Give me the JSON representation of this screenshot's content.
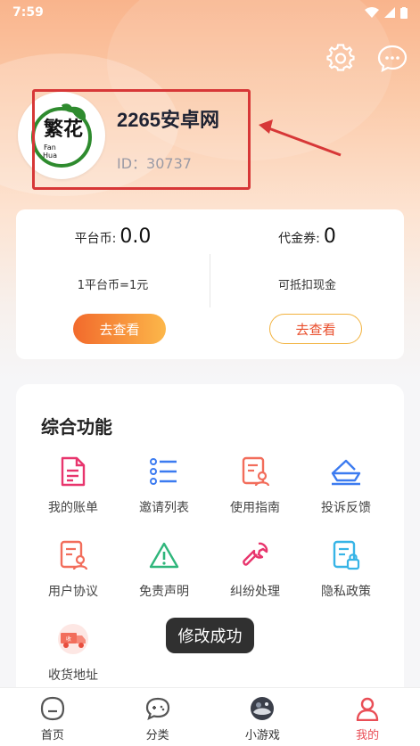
{
  "status_bar": {
    "time": "7:59"
  },
  "profile": {
    "name": "2265安卓网",
    "id_text": "ID：30737",
    "logo_text": "繁花",
    "logo_sub1": "Fan",
    "logo_sub2": "Hua"
  },
  "wallet": {
    "platform_coin_label": "平台币:",
    "platform_coin_value": "0.0",
    "platform_coin_rate": "1平台币=1元",
    "platform_coin_button": "去查看",
    "voucher_label": "代金券:",
    "voucher_value": "0",
    "voucher_desc": "可抵扣现金",
    "voucher_button": "去查看"
  },
  "functions": {
    "title": "综合功能",
    "items": [
      {
        "label": "我的账单",
        "icon": "bill-icon",
        "color": "#e8356d"
      },
      {
        "label": "邀请列表",
        "icon": "list-icon",
        "color": "#3c7bf0"
      },
      {
        "label": "使用指南",
        "icon": "guide-icon",
        "color": "#f26d5b"
      },
      {
        "label": "投诉反馈",
        "icon": "feedback-icon",
        "color": "#3c7bf0"
      },
      {
        "label": "用户协议",
        "icon": "agreement-icon",
        "color": "#f26d5b"
      },
      {
        "label": "免责声明",
        "icon": "warning-icon",
        "color": "#2fb67b"
      },
      {
        "label": "纠纷处理",
        "icon": "wrench-icon",
        "color": "#e8356d"
      },
      {
        "label": "隐私政策",
        "icon": "privacy-icon",
        "color": "#37b4e6"
      },
      {
        "label": "收货地址",
        "icon": "delivery-truck-icon",
        "color": "#f26d5b"
      }
    ]
  },
  "toast": {
    "text": "修改成功"
  },
  "tabbar": {
    "items": [
      {
        "label": "首页",
        "icon": "home-icon"
      },
      {
        "label": "分类",
        "icon": "category-icon"
      },
      {
        "label": "小游戏",
        "icon": "mini-game-icon"
      },
      {
        "label": "我的",
        "icon": "profile-icon",
        "active": true
      }
    ]
  },
  "colors": {
    "accent": "#e94e56",
    "highlight": "#d73737"
  }
}
